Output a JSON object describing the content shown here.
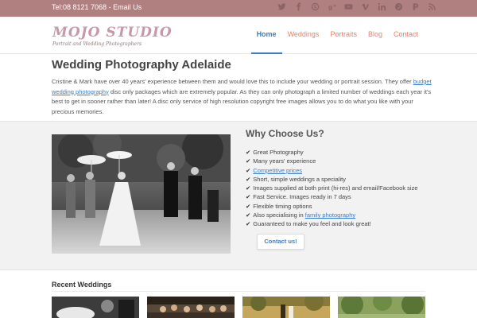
{
  "topbar": {
    "tel": "Tel:08 8121 7068",
    "sep": " - ",
    "email": "Email Us",
    "social_icons": [
      "twitter-icon",
      "facebook-icon",
      "skype-icon",
      "google-plus-icon",
      "youtube-icon",
      "vimeo-icon",
      "linkedin-icon",
      "pinterest-icon",
      "flickr-icon",
      "rss-icon"
    ]
  },
  "logo": {
    "name": "MOJO STUDIO",
    "tagline": "Portrait and Wedding Photographers"
  },
  "nav": {
    "items": [
      {
        "label": "Home",
        "active": true
      },
      {
        "label": "Weddings"
      },
      {
        "label": "Portraits"
      },
      {
        "label": "Blog"
      },
      {
        "label": "Contact"
      }
    ]
  },
  "intro": {
    "title": "Wedding Photography Adelaide",
    "p1": "Cristine & Mark have over 40 years' experience between them and would love this to include your wedding or portrait session. They offer ",
    "link": "budget wedding photography",
    "p2": " disc only packages which are extremely popular. As they can only photograph a limited number of weddings each year it's best to get in sooner rather than later! A disc only service of high resolution copyright free images allows you to do what you like with your precious memories."
  },
  "why": {
    "title": "Why Choose Us?",
    "items": [
      {
        "text": "Great Photography"
      },
      {
        "text": "Many years' experience"
      },
      {
        "link": "Competitive prices"
      },
      {
        "text": "Short, simple weddings a speciality"
      },
      {
        "text": "Images supplied at both print (hi-res) and email/Facebook size"
      },
      {
        "text": "Fast Service. Images ready in 7 days"
      },
      {
        "text": "Flexible timing options"
      },
      {
        "text": "Also specialising in ",
        "link": "family photography"
      },
      {
        "text": "Guaranteed to make you feel and look great!"
      }
    ],
    "button": "Contact us!"
  },
  "recent": {
    "title": "Recent Weddings"
  },
  "colors": {
    "topbar": "#b07f80",
    "accent_blue": "#3b7ec8",
    "nav_orange": "#e4826a",
    "logo_pink": "#c898a6"
  }
}
